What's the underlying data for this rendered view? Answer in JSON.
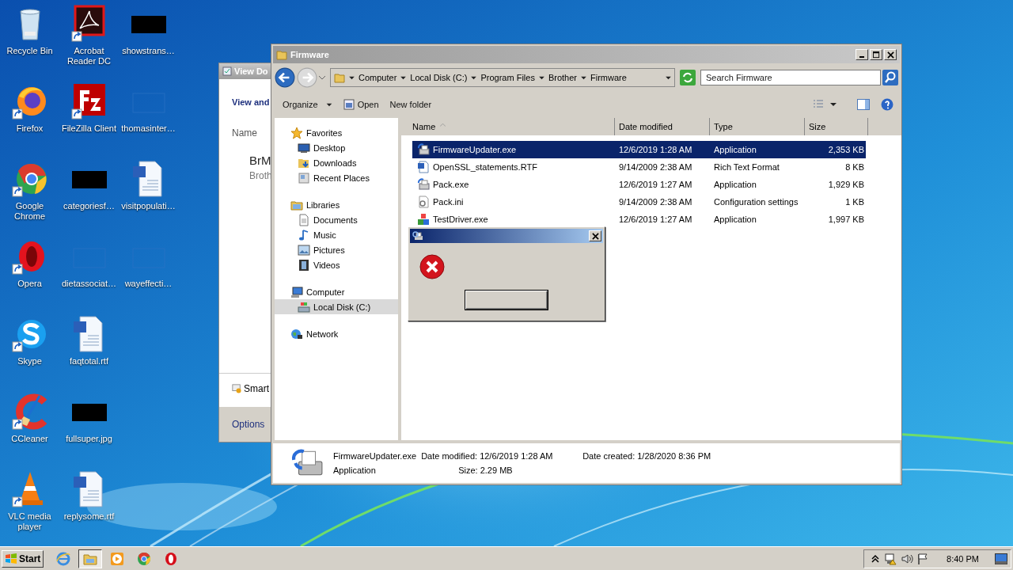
{
  "desktop_icons": [
    {
      "label": "Recycle Bin",
      "kind": "recycle",
      "shortcut": false
    },
    {
      "label": "Firefox",
      "kind": "firefox",
      "shortcut": true
    },
    {
      "label": "Google Chrome",
      "kind": "chrome",
      "shortcut": true
    },
    {
      "label": "Opera",
      "kind": "opera",
      "shortcut": true
    },
    {
      "label": "Skype",
      "kind": "skype",
      "shortcut": true
    },
    {
      "label": "CCleaner",
      "kind": "ccleaner",
      "shortcut": true
    },
    {
      "label": "VLC media player",
      "kind": "vlc",
      "shortcut": true
    },
    {
      "label": "Acrobat Reader DC",
      "kind": "acrobat",
      "shortcut": true
    },
    {
      "label": "FileZilla Client",
      "kind": "filezilla",
      "shortcut": true
    },
    {
      "label": "categoriesf…",
      "kind": "black",
      "shortcut": false
    },
    {
      "label": "dietassociat…",
      "kind": "blank",
      "shortcut": false
    },
    {
      "label": "faqtotal.rtf",
      "kind": "word",
      "shortcut": false
    },
    {
      "label": "fullsuper.jpg",
      "kind": "black",
      "shortcut": false
    },
    {
      "label": "replysome.rtf",
      "kind": "word",
      "shortcut": false
    },
    {
      "label": "showstrans…",
      "kind": "black",
      "shortcut": false
    },
    {
      "label": "thomasinter…",
      "kind": "blank",
      "shortcut": false
    },
    {
      "label": "visitpopulati…",
      "kind": "word",
      "shortcut": false
    },
    {
      "label": "wayeffecti…",
      "kind": "blank",
      "shortcut": false
    }
  ],
  "background_window": {
    "title": "View Do",
    "heading": "View and",
    "column": "Name",
    "item_title": "BrM",
    "item_subtitle": "Broth",
    "footer_item": "Smart",
    "footer_link": "Options"
  },
  "explorer": {
    "title": "Firmware",
    "breadcrumb": [
      "Computer",
      "Local Disk (C:)",
      "Program Files",
      "Brother",
      "Firmware"
    ],
    "search": {
      "placeholder": "Search Firmware"
    },
    "toolbar": [
      {
        "label": "Organize",
        "kind": "menu"
      },
      {
        "label": "Open",
        "kind": "open"
      },
      {
        "label": "New folder",
        "kind": "plain"
      }
    ],
    "nav": [
      {
        "label": "Favorites",
        "kind": "star",
        "selected": false,
        "children": [
          {
            "label": "Desktop",
            "kind": "desktop",
            "selected": false
          },
          {
            "label": "Downloads",
            "kind": "downloads",
            "selected": false
          },
          {
            "label": "Recent Places",
            "kind": "recent",
            "selected": false
          }
        ]
      },
      {
        "label": "Libraries",
        "kind": "libraries",
        "selected": false,
        "children": [
          {
            "label": "Documents",
            "kind": "documents",
            "selected": false
          },
          {
            "label": "Music",
            "kind": "music",
            "selected": false
          },
          {
            "label": "Pictures",
            "kind": "pictures",
            "selected": false
          },
          {
            "label": "Videos",
            "kind": "videos",
            "selected": false
          }
        ]
      },
      {
        "label": "Computer",
        "kind": "computer",
        "selected": false,
        "children": [
          {
            "label": "Local Disk (C:)",
            "kind": "disk",
            "selected": true
          }
        ]
      },
      {
        "label": "Network",
        "kind": "network",
        "selected": false
      }
    ],
    "columns": [
      "Name",
      "Date modified",
      "Type",
      "Size"
    ],
    "files": [
      {
        "name": "FirmwareUpdater.exe",
        "kind": "app",
        "date": "12/6/2019 1:28 AM",
        "type": "Application",
        "size": "2,353 KB",
        "selected": true
      },
      {
        "name": "OpenSSL_statements.RTF",
        "kind": "rtf",
        "date": "9/14/2009 2:38 AM",
        "type": "Rich Text Format",
        "size": "8 KB",
        "selected": false
      },
      {
        "name": "Pack.exe",
        "kind": "app",
        "date": "12/6/2019 1:27 AM",
        "type": "Application",
        "size": "1,929 KB",
        "selected": false
      },
      {
        "name": "Pack.ini",
        "kind": "ini",
        "date": "9/14/2009 2:38 AM",
        "type": "Configuration settings",
        "size": "1 KB",
        "selected": false
      },
      {
        "name": "TestDriver.exe",
        "kind": "blocks",
        "date": "12/6/2019 1:27 AM",
        "type": "Application",
        "size": "1,997 KB",
        "selected": false
      }
    ],
    "details": {
      "name": "FirmwareUpdater.exe",
      "type": "Application",
      "modified": "Date modified: 12/6/2019 1:28 AM",
      "size": "Size: 2.29 MB",
      "created": "Date created: 1/28/2020 8:36 PM"
    }
  },
  "taskbar": {
    "start": "Start",
    "apps": [
      {
        "kind": "ie",
        "selected": false
      },
      {
        "kind": "explorer",
        "selected": true
      },
      {
        "kind": "media",
        "selected": false
      },
      {
        "kind": "chrome",
        "selected": false
      },
      {
        "kind": "opera",
        "selected": false
      }
    ],
    "tray": [
      {
        "kind": "chevron"
      },
      {
        "kind": "network"
      },
      {
        "kind": "volume"
      },
      {
        "kind": "flag"
      }
    ],
    "clock": "8:40 PM"
  }
}
